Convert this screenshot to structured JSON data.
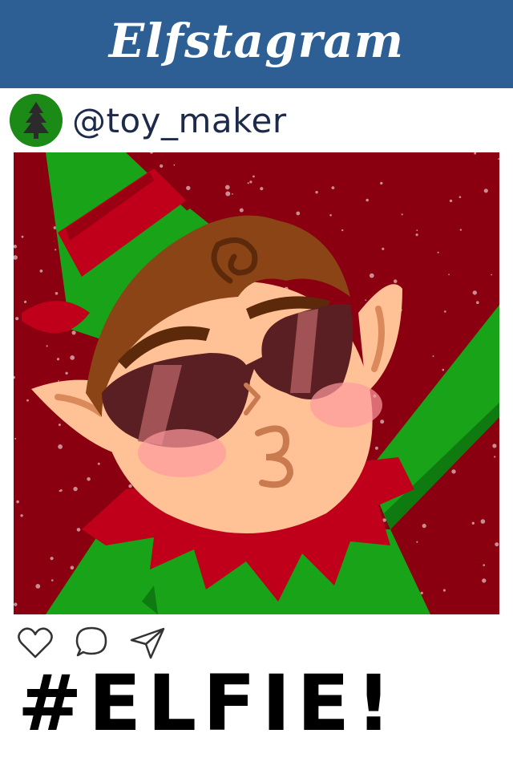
{
  "app": {
    "title": "Elfstagram",
    "brand_color": "#2d5e94"
  },
  "post": {
    "username": "@toy_maker",
    "avatar_icon": "pine-tree-icon",
    "photo_description": "elf-selfie",
    "actions": [
      {
        "name": "like",
        "icon": "heart-icon"
      },
      {
        "name": "comment",
        "icon": "speech-bubble-icon"
      },
      {
        "name": "share",
        "icon": "paper-plane-icon"
      }
    ],
    "caption": "#ELFIE!"
  },
  "colors": {
    "elf_green": "#19a319",
    "elf_red": "#c0001a",
    "snow_bg": "#8a0010",
    "skin": "#ffc195",
    "hair": "#8a4416"
  }
}
